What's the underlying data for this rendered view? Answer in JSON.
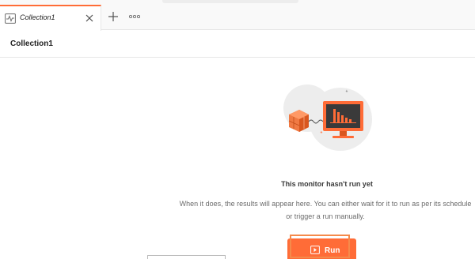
{
  "tabs": [
    {
      "label": "Collection1",
      "icon": "monitor-activity-icon",
      "active": true
    }
  ],
  "tabbar": {
    "new_tab_icon": "plus-icon",
    "more_icon": "ellipsis-icon"
  },
  "header": {
    "title": "Collection1"
  },
  "empty_state": {
    "title": "This monitor hasn't run yet",
    "description": "When it does, the results will appear here. You can either wait for it to run as per its schedule or trigger a run manually.",
    "illustration": "monitor-illustration"
  },
  "actions": {
    "run_label": "Run",
    "run_icon": "play-icon"
  },
  "colors": {
    "accent": "#ff6c37",
    "border": "#e6e6e6",
    "text_muted": "#6b6b6b"
  }
}
